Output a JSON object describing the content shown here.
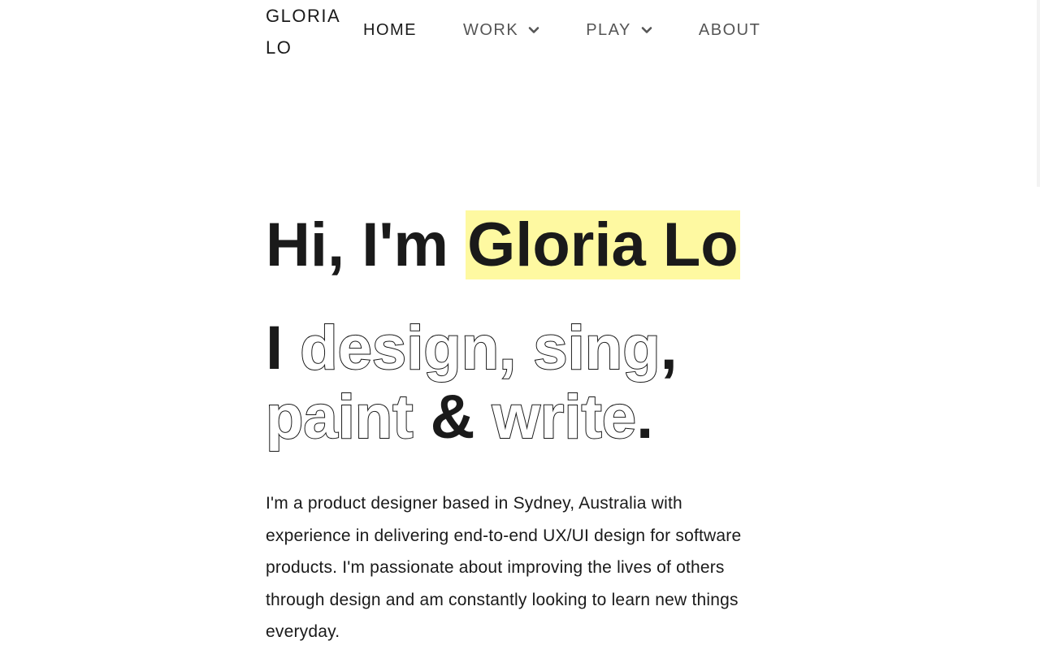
{
  "logo": {
    "line1": "GLORIA",
    "line2": "LO"
  },
  "nav": {
    "items": [
      {
        "label": "HOME",
        "active": true,
        "dropdown": false
      },
      {
        "label": "WORK",
        "active": false,
        "dropdown": true
      },
      {
        "label": "PLAY",
        "active": false,
        "dropdown": true
      },
      {
        "label": "ABOUT",
        "active": false,
        "dropdown": false
      }
    ],
    "dropdown_icon": "chevron-down-icon"
  },
  "hero": {
    "greeting": "Hi, I'm ",
    "name": "Gloria Lo",
    "highlight_color": "#fef9a1"
  },
  "tagline": {
    "prefix": "I ",
    "design": "design,",
    "sing": "sing,",
    "comma": ",",
    "paint": "paint",
    "amp": "&",
    "write": "write",
    "period": "."
  },
  "intro": {
    "text": "I'm a product designer based in Sydney, Australia with experience in delivering end-to-end UX/UI design for software products. I'm passionate about improving the lives of others through design and am constantly looking to learn new things everyday."
  },
  "colors": {
    "text": "#1a1a1a",
    "nav_inactive": "#555555",
    "background": "#ffffff"
  }
}
